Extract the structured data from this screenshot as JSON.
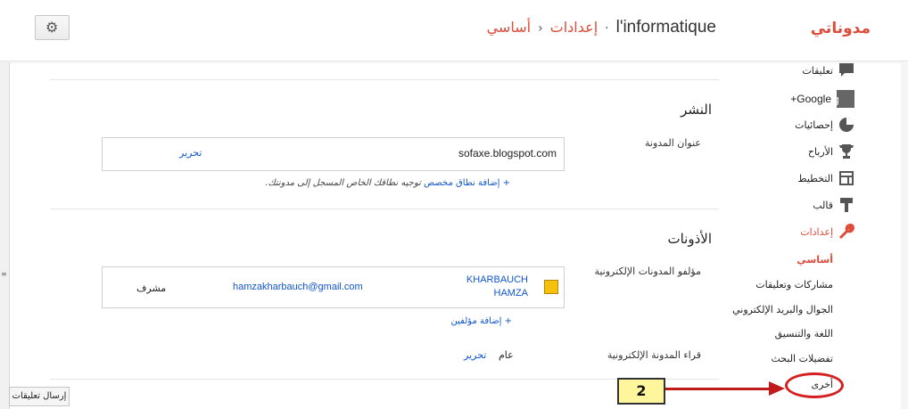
{
  "header": {
    "brand": "مدوناتي",
    "blog_name": "l'informatique",
    "crumb_settings": "إعدادات",
    "crumb_basic": "أساسي",
    "separator": "›",
    "dot": "·"
  },
  "sidebar": {
    "items": [
      {
        "label": "تعليقات",
        "icon": "comment-icon"
      },
      {
        "label": "Google+",
        "icon": "google-plus-icon"
      },
      {
        "label": "إحصائيات",
        "icon": "stats-pie-icon"
      },
      {
        "label": "الأرباح",
        "icon": "trophy-icon"
      },
      {
        "label": "التخطيط",
        "icon": "layout-icon"
      },
      {
        "label": "قالب",
        "icon": "template-brush-icon"
      },
      {
        "label": "إعدادات",
        "icon": "wrench-icon"
      }
    ],
    "subitems": [
      "أساسي",
      "مشاركات وتعليقات",
      "الجوال والبريد الإلكتروني",
      "اللغة والتنسيق",
      "تفضيلات البحث",
      "أخرى"
    ]
  },
  "publishing": {
    "title": "النشر",
    "address_label": "عنوان المدونة",
    "address_value": "sofaxe.blogspot.com",
    "edit": "تحرير",
    "add_domain_link": "+ إضافة نطاق مخصص",
    "add_domain_note": "توجيه نطاقك الخاص المسجل إلى مدونتك."
  },
  "permissions": {
    "title": "الأذونات",
    "authors_label": "مؤلفو المدونات الإلكترونية",
    "author_name_1": "KHARBAUCH",
    "author_name_2": "HAMZA",
    "author_email": "hamzakharbauch@gmail.com",
    "author_role": "مشرف",
    "add_authors": "+ إضافة مؤلفين",
    "readers_label": "قراء المدونة الإلكترونية",
    "readers_value": "عام",
    "readers_edit": "تحرير"
  },
  "annotation": {
    "number": "2"
  },
  "footer": {
    "feedback": "إرسال تعليقات"
  },
  "colors": {
    "accent": "#dd4b39",
    "link": "#1155cc",
    "annotation_red": "#d42020",
    "callout_bg": "#fff59d"
  }
}
